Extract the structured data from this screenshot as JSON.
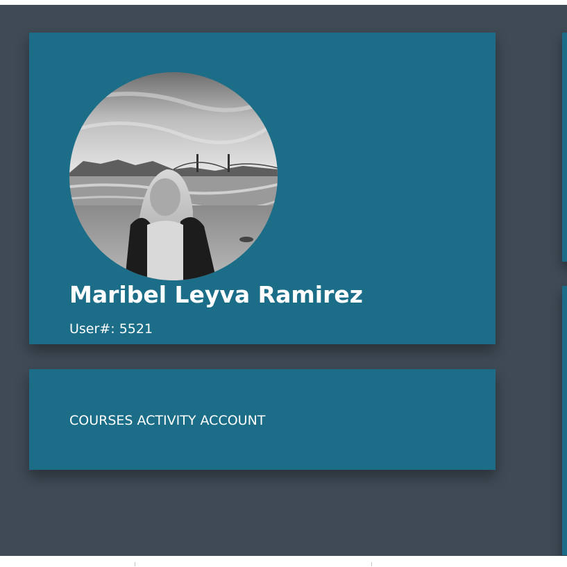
{
  "profile": {
    "name": "Maribel Leyva Ramirez",
    "user_label": "User#:",
    "user_number": "5521",
    "avatar_icon": "profile-photo"
  },
  "nav": {
    "items": [
      {
        "label": "COURSES"
      },
      {
        "label": "ACTIVITY"
      },
      {
        "label": "ACCOUNT"
      }
    ]
  },
  "colors": {
    "page_background": "#3f4a55",
    "card_background": "#1b6d88",
    "text": "#ffffff"
  }
}
